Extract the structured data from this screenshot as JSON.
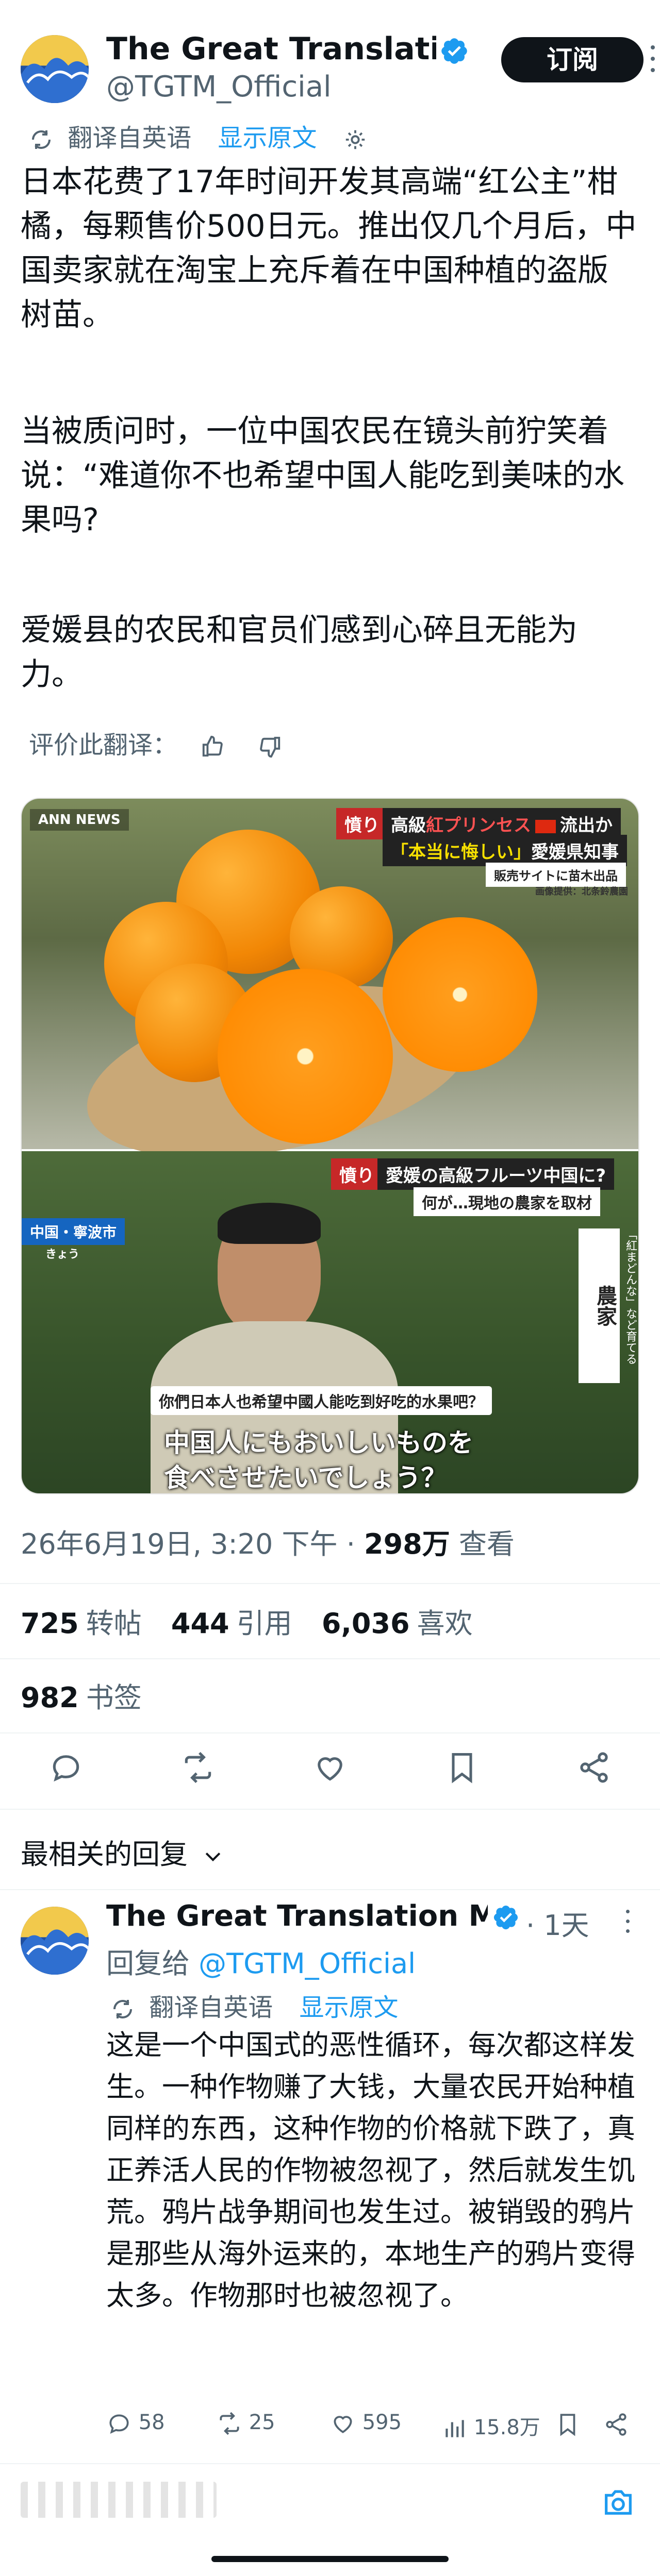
{
  "tweet": {
    "author_name": "The Great Translatio...",
    "author_handle": "@TGTM_Official",
    "subscribe_label": "订阅",
    "translated_from": "翻译自英语",
    "show_original": "显示原文",
    "paragraphs": [
      "日本花费了17年时间开发其高端“红公主”柑橘，每颗售价500日元。推出仅几个月后，中国卖家就在淘宝上充斥着在中国种植的盗版树苗。",
      "当被质问时，一位中国农民在镜头前狞笑着说：“难道你不也希望中国人能吃到美味的水果吗?",
      "爱媛县的农民和官员们感到心碎且无能为力。"
    ],
    "rate_translation": "评价此翻译：",
    "image": {
      "top_logo": "ANN NEWS",
      "top_tag": "憤り",
      "top_headline_1a": "高級",
      "top_headline_1b": "紅プリンセス",
      "top_headline_1c": "流出か",
      "top_headline_2a": "「本当に悔しい」",
      "top_headline_2b": "愛媛県知事",
      "top_sub": "販売サイトに苗木出品",
      "top_credit": "画像提供：北条鈴農園",
      "bottom_tag": "憤り",
      "bottom_headline": "愛媛の高級フルーツ中国に?",
      "bottom_sub": "何が…現地の農家を取材",
      "location": "中国・寧波市",
      "location_sub": "きょう",
      "vertical_label": "農家",
      "vertical_quote": "「紅まどんな」など育てる",
      "subtitle_cn": "你們日本人也希望中國人能吃到好吃的水果吧？",
      "subtitle_jp_1": "中国人にもおいしいものを",
      "subtitle_jp_2": "食べさせたいでしょう？"
    },
    "timestamp": "26年6月19日, 3:20 下午 · ",
    "views_count": "298万",
    "views_label": " 查看",
    "retweets": "725",
    "retweets_label": "转帖",
    "quotes": "444",
    "quotes_label": "引用",
    "likes": "6,036",
    "likes_label": "喜欢",
    "bookmarks": "982",
    "bookmarks_label": "书签"
  },
  "replies_sort": "最相关的回复",
  "reply": {
    "author_name": "The Great Translation M...",
    "age": "· 1天",
    "reply_to_prefix": "回复给 ",
    "reply_to_handle": "@TGTM_Official",
    "translated_from": "翻译自英语",
    "show_original": "显示原文",
    "text": "这是一个中国式的恶性循环，每次都这样发生。一种作物赚了大钱，大量农民开始种植同样的东西，这种作物的价格就下跌了，真正养活人民的作物被忽视了，然后就发生饥荒。鸦片战争期间也发生过。被销毁的鸦片是那些从海外运来的，本地生产的鸦片变得太多。作物那时也被忽视了。",
    "replies": "58",
    "retweets": "25",
    "likes": "595",
    "views": "15.8万"
  },
  "colors": {
    "accent": "#1d9bf0",
    "text": "#0f1419",
    "muted": "#536471",
    "verified": "#1d9bf0"
  },
  "icons": [
    "translate-icon",
    "gear-icon",
    "thumbs-up-icon",
    "thumbs-down-icon",
    "reply-icon",
    "retweet-icon",
    "heart-icon",
    "bookmark-icon",
    "share-icon",
    "views-icon",
    "camera-icon",
    "verified-badge-icon",
    "chevron-down-icon",
    "more-icon"
  ]
}
